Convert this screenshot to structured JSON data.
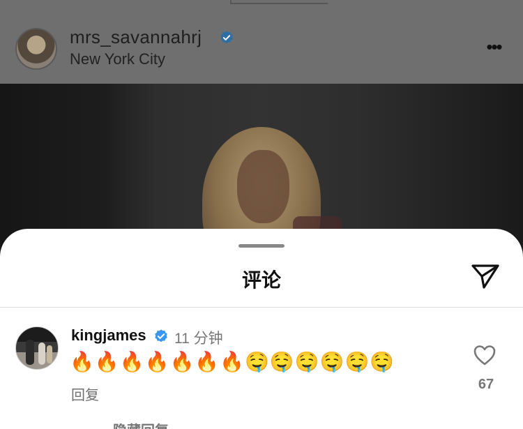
{
  "post": {
    "username": "mrs_savannahrj",
    "location": "New York City",
    "more_icon": "more-horizontal-icon"
  },
  "comments_sheet": {
    "title": "评论",
    "share_icon": "send-icon",
    "comment": {
      "username": "kingjames",
      "time": "11 分钟",
      "text": "🔥🔥🔥🔥🔥🔥🔥🤤🤤🤤🤤🤤🤤",
      "reply_label": "回复",
      "like_count": "67",
      "like_icon": "heart-outline-icon"
    },
    "next_line_partial": "隐藏回复"
  },
  "colors": {
    "verified_badge": "#3897f0",
    "dim_overlay": "#6f6f6f"
  }
}
